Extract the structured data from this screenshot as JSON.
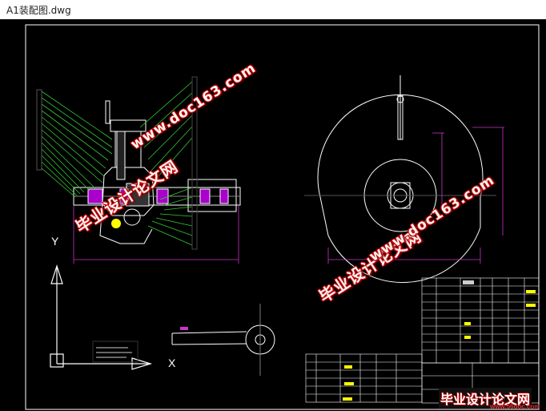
{
  "window": {
    "title": "A1装配图.dwg"
  },
  "axes": {
    "y_label": "Y",
    "x_label": "X"
  },
  "watermarks": [
    {
      "text": "www.doc163.com"
    },
    {
      "text": "毕业设计论文网"
    },
    {
      "text": "毕业设计论文网"
    },
    {
      "text": "www.doc163.com"
    }
  ],
  "brand": {
    "name": "毕业设计论文网",
    "url": "www.56doc.com"
  },
  "colors": {
    "background": "#000000",
    "lines": "#ffffff",
    "leaders": "#33cc33",
    "dimensions": "#cc33cc",
    "highlight": "#ffff00"
  }
}
